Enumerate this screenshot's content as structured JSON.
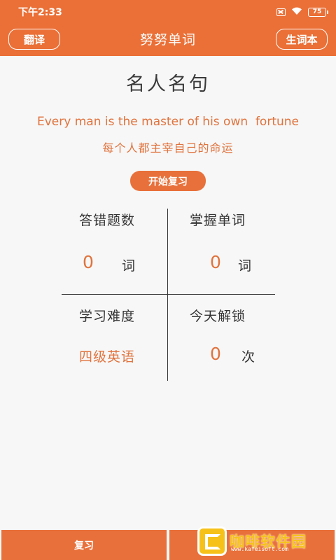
{
  "status_bar": {
    "time": "下午2:33",
    "battery": "75"
  },
  "app_bar": {
    "title": "努努单词",
    "left_button": "翻译",
    "right_button": "生词本"
  },
  "quote": {
    "heading": "名人名句",
    "english": "Every man is the master of his own  fortune",
    "chinese": "每个人都主宰自己的命运"
  },
  "start_review_button": "开始复习",
  "stats": {
    "wrong_answers": {
      "label": "答错题数",
      "value": "0",
      "unit": "词"
    },
    "mastered_words": {
      "label": "掌握单词",
      "value": "0",
      "unit": "词"
    },
    "difficulty": {
      "label": "学习难度",
      "value": "四级英语"
    },
    "unlocked_today": {
      "label": "今天解锁",
      "value": "0",
      "unit": "次"
    }
  },
  "bottom_nav": {
    "review": "复习",
    "other": ""
  },
  "watermark": {
    "text": "咖啡软件园",
    "sub": "www.kafeisoft.com"
  },
  "colors": {
    "accent": "#ea7037",
    "text_accent": "#e0733d"
  }
}
